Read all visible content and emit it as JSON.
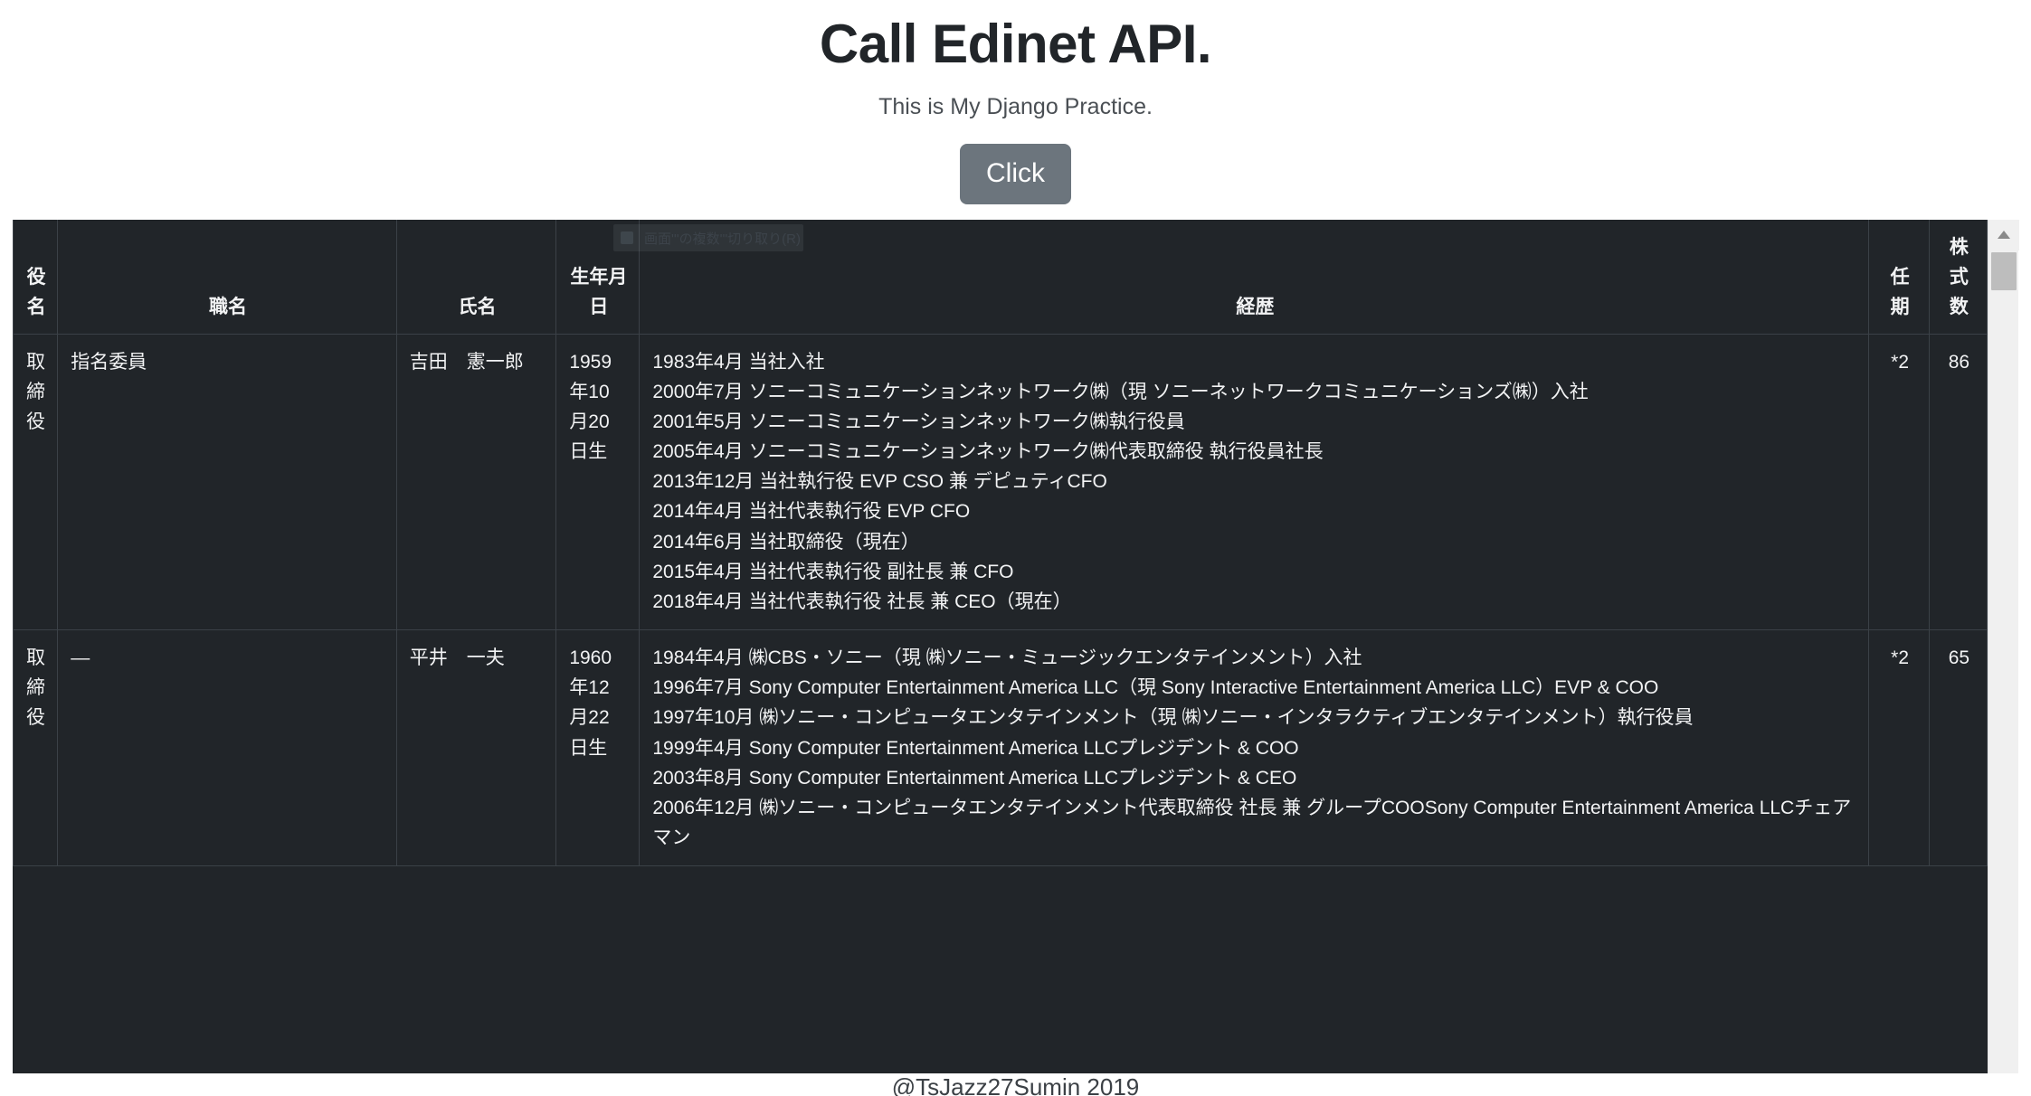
{
  "header": {
    "title": "Call Edinet API.",
    "subtitle": "This is My Django Practice.",
    "button_label": "Click"
  },
  "ghost_menu": {
    "label": "画面'''の複数'''切り取り(R)"
  },
  "table": {
    "columns": [
      {
        "key": "yakumei",
        "label": "役名"
      },
      {
        "key": "shokumei",
        "label": "職名"
      },
      {
        "key": "shimei",
        "label": "氏名"
      },
      {
        "key": "seinen",
        "label": "生年月日"
      },
      {
        "key": "keireki",
        "label": "経歴"
      },
      {
        "key": "ninki",
        "label": "任期"
      },
      {
        "key": "kabu",
        "label": "株式数"
      }
    ],
    "rows": [
      {
        "yakumei": "取締役",
        "shokumei": "指名委員",
        "shimei": "吉田　憲一郎",
        "seinen": "1959年10月20日生",
        "keireki": [
          "1983年4月 当社入社",
          "2000年7月 ソニーコミュニケーションネットワーク㈱（現 ソニーネットワークコミュニケーションズ㈱）入社",
          "2001年5月 ソニーコミュニケーションネットワーク㈱執行役員",
          "2005年4月 ソニーコミュニケーションネットワーク㈱代表取締役 執行役員社長",
          "2013年12月 当社執行役 EVP CSO 兼 デピュティCFO",
          "2014年4月 当社代表執行役 EVP CFO",
          "2014年6月 当社取締役（現在）",
          "2015年4月 当社代表執行役 副社長 兼 CFO",
          "2018年4月 当社代表執行役 社長 兼 CEO（現在）"
        ],
        "ninki": "*2",
        "kabu": "86"
      },
      {
        "yakumei": "取締役",
        "shokumei": "―",
        "shimei": "平井　一夫",
        "seinen": "1960年12月22日生",
        "keireki": [
          "1984年4月 ㈱CBS・ソニー（現 ㈱ソニー・ミュージックエンタテインメント）入社",
          "1996年7月 Sony Computer Entertainment America LLC（現 Sony Interactive Entertainment America LLC）EVP & COO",
          "1997年10月 ㈱ソニー・コンピュータエンタテインメント（現 ㈱ソニー・インタラクティブエンタテインメント）執行役員",
          "1999年4月 Sony Computer Entertainment America LLCプレジデント & COO",
          "2003年8月 Sony Computer Entertainment America LLCプレジデント & CEO",
          "2006年12月 ㈱ソニー・コンピュータエンタテインメント代表取締役 社長 兼 グループCOOSony Computer Entertainment America LLCチェアマン"
        ],
        "ninki": "*2",
        "kabu": "65"
      }
    ]
  },
  "footer": {
    "text": "@TsJazz27Sumin 2019"
  }
}
